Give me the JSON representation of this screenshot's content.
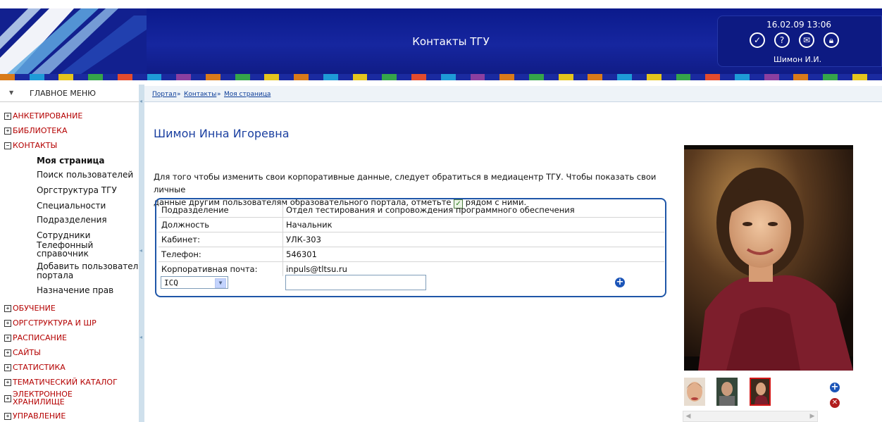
{
  "header": {
    "title": "Контакты ТГУ",
    "datetime": "16.02.09 13:06",
    "user": "Шимон И.И.",
    "icons": [
      "check-icon",
      "help-icon",
      "mail-icon",
      "lock-icon"
    ],
    "stripe_colors": [
      "#d97a1a",
      "#1e9bd7",
      "#e4c51d",
      "#35a54a",
      "#e34b2d",
      "#1e9bd7",
      "#8b3fa0",
      "#d97a1a",
      "#35a54a",
      "#e4c51d"
    ]
  },
  "sidebar": {
    "title": "ГЛАВНОЕ МЕНЮ",
    "items": [
      {
        "label": "АНКЕТИРОВАНИЕ",
        "toggle": "+"
      },
      {
        "label": "БИБЛИОТЕКА",
        "toggle": "+"
      },
      {
        "label": "КОНТАКТЫ",
        "toggle": "−"
      },
      {
        "label": "ОБУЧЕНИЕ",
        "toggle": "+"
      },
      {
        "label": "ОРГСТРУКТУРА И ШР",
        "toggle": "+"
      },
      {
        "label": "РАСПИСАНИЕ",
        "toggle": "+"
      },
      {
        "label": "САЙТЫ",
        "toggle": "+"
      },
      {
        "label": "СТАТИСТИКА",
        "toggle": "+"
      },
      {
        "label": "ТЕМАТИЧЕСКИЙ КАТАЛОГ",
        "toggle": "+"
      },
      {
        "label_line1": "ЭЛЕКТРОННОЕ",
        "label_line2": "ХРАНИЛИЩЕ",
        "toggle": "+"
      },
      {
        "label": "УПРАВЛЕНИЕ",
        "toggle": "+"
      }
    ],
    "contacts_sub": [
      {
        "label": "Моя страница"
      },
      {
        "label": "Поиск пользователей"
      },
      {
        "label": "Оргструктура ТГУ"
      },
      {
        "label": "Специальности"
      },
      {
        "label": "Подразделения"
      },
      {
        "label": "Сотрудники"
      },
      {
        "label_line1": "Телефонный",
        "label_line2": "справочник"
      },
      {
        "label_line1": "Добавить пользователя",
        "label_line2": "портала"
      },
      {
        "label": "Назначение прав"
      }
    ]
  },
  "breadcrumb": {
    "items": [
      "Портал",
      "Контакты",
      "Моя страница"
    ],
    "separator": "»"
  },
  "profile": {
    "name": "Шимон Инна Игоревна",
    "info_line1": "Для того чтобы изменить свои корпоративные данные, следует обратиться в медиацентр ТГУ. Чтобы показать свои личные",
    "info_line2_a": "данные другим пользователям образовательного портала, отметьте",
    "info_line2_b": "рядом с ними.",
    "fields": [
      {
        "label": "Подразделение",
        "value": "Отдел тестирования и сопровождения программного обеспечения"
      },
      {
        "label": "Должность",
        "value": "Начальник"
      },
      {
        "label": "Кабинет:",
        "value": "УЛК-303"
      },
      {
        "label": "Телефон:",
        "value": "546301"
      },
      {
        "label": "Корпоративная почта:",
        "value": "inpuls@tltsu.ru"
      }
    ],
    "contact_type_selected": "ICQ",
    "contact_value": ""
  }
}
